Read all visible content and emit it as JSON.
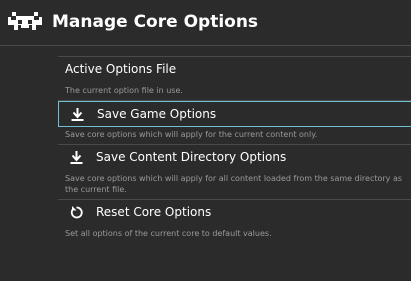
{
  "header": {
    "title": "Manage Core Options",
    "logo_icon": "retroarch-invader-icon"
  },
  "menu": {
    "items": [
      {
        "label": "Active Options File",
        "sublabel": "The current option file in use.",
        "icon": null,
        "selected": false
      },
      {
        "label": "Save Game Options",
        "sublabel": "Save core options which will apply for the current content only.",
        "icon": "download-icon",
        "selected": true
      },
      {
        "label": "Save Content Directory Options",
        "sublabel": "Save core options which will apply for all content loaded from the same directory as the current file.",
        "icon": "download-icon",
        "selected": false
      },
      {
        "label": "Reset Core Options",
        "sublabel": "Set all options of the current core to default values.",
        "icon": "reset-icon",
        "selected": false
      }
    ]
  },
  "colors": {
    "background": "#2b2b2b",
    "selection_border": "#6fbfd4",
    "divider": "#4a4a4a",
    "sublabel": "#9a9a9a"
  }
}
